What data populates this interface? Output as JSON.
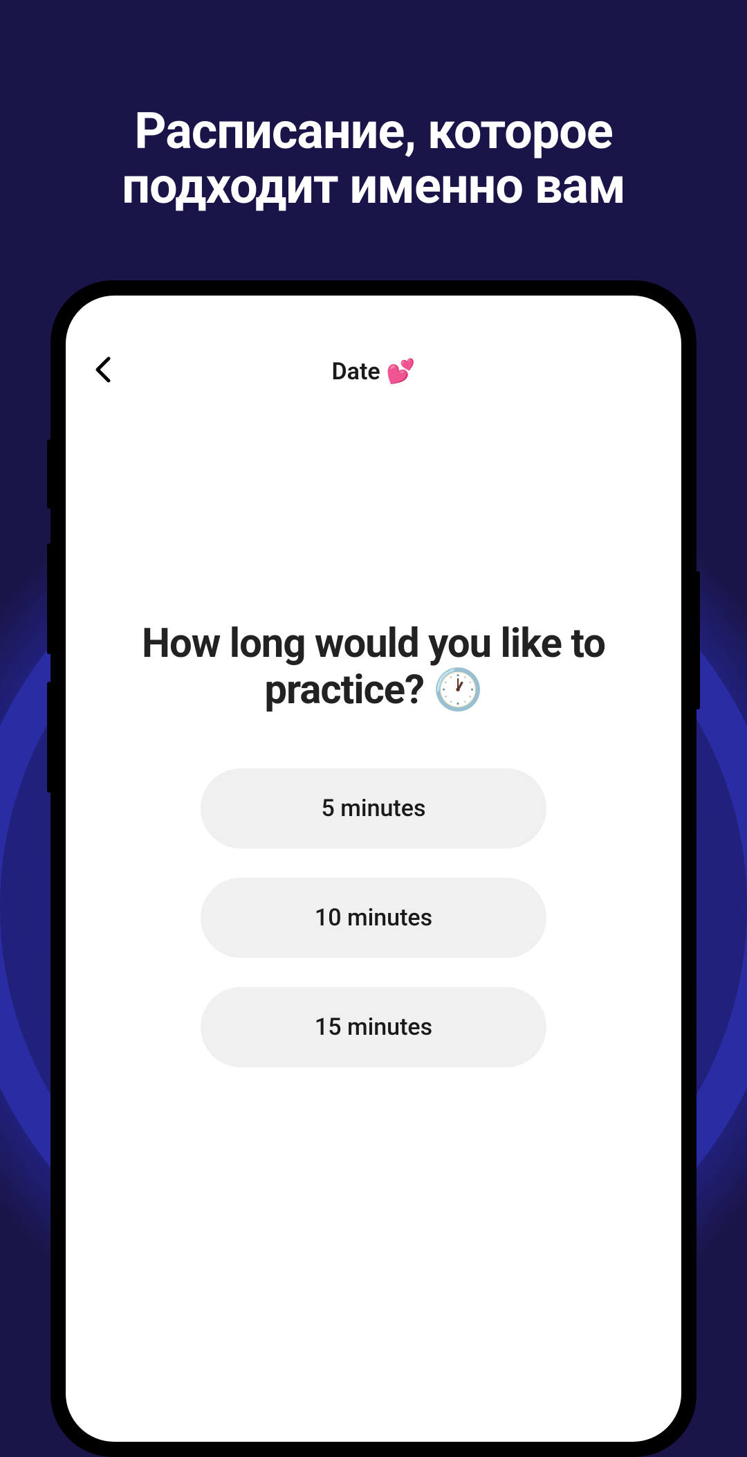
{
  "promo": {
    "headline": "Расписание, которое подходит именно вам"
  },
  "app": {
    "header": {
      "title": "Date 💕"
    },
    "question": "How long would you like to practice? 🕐",
    "options": [
      {
        "label": "5 minutes"
      },
      {
        "label": "10 minutes"
      },
      {
        "label": "15 minutes"
      }
    ]
  }
}
